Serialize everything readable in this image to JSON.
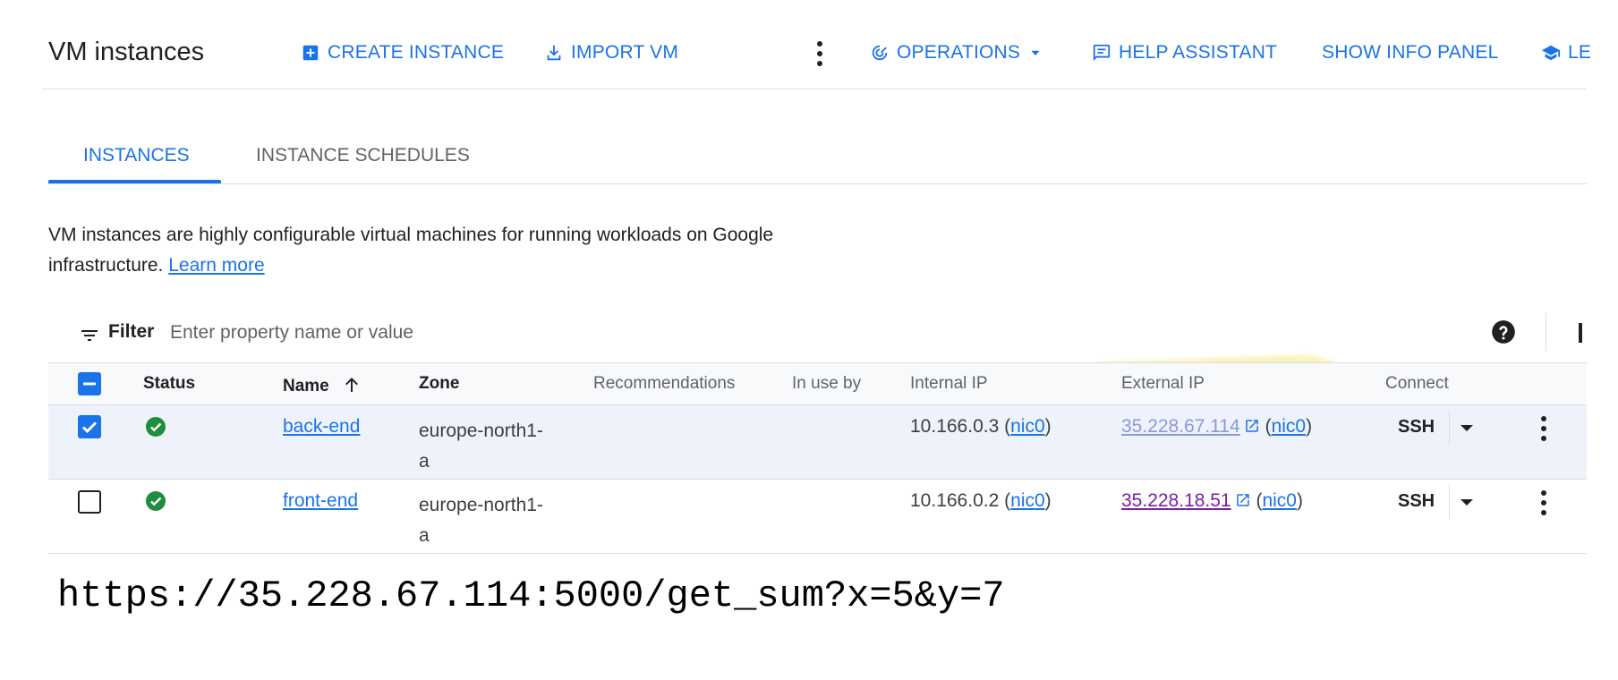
{
  "toolbar": {
    "title": "VM instances",
    "create_instance": "CREATE INSTANCE",
    "import_vm": "IMPORT VM",
    "operations": "OPERATIONS",
    "help_assistant": "HELP ASSISTANT",
    "show_info_panel": "SHOW INFO PANEL",
    "learn_truncated": "LE",
    "accent_color": "#1a73e8"
  },
  "tabs": [
    {
      "label": "INSTANCES",
      "active": true
    },
    {
      "label": "INSTANCE SCHEDULES",
      "active": false
    }
  ],
  "description": {
    "text": "VM instances are highly configurable virtual machines for running workloads on Google infrastructure.",
    "link": "Learn more"
  },
  "filter": {
    "label": "Filter",
    "placeholder": "Enter property name or value"
  },
  "table": {
    "columns": [
      "Status",
      "Name",
      "Zone",
      "Recommendations",
      "In use by",
      "Internal IP",
      "External IP",
      "Connect"
    ],
    "sort": {
      "column": "Name",
      "direction": "ascending"
    },
    "rows": [
      {
        "selected": true,
        "status": "running",
        "name": "back-end",
        "zone_line1": "europe-north1-",
        "zone_line2": "a",
        "recommendations": "",
        "in_use_by": "",
        "internal_ip": "10.166.0.3",
        "internal_nic": "nic0",
        "external_ip": "35.228.67.114",
        "external_nic": "nic0",
        "connect": "SSH"
      },
      {
        "selected": false,
        "status": "running",
        "name": "front-end",
        "zone_line1": "europe-north1-",
        "zone_line2": "a",
        "recommendations": "",
        "in_use_by": "",
        "internal_ip": "10.166.0.2",
        "internal_nic": "nic0",
        "external_ip": "35.228.18.51",
        "external_nic": "nic0",
        "connect": "SSH"
      }
    ]
  },
  "annotation": {
    "url": "https://35.228.67.114:5000/get_sum?x=5&y=7",
    "highlight_color": "#f5f0a3"
  }
}
